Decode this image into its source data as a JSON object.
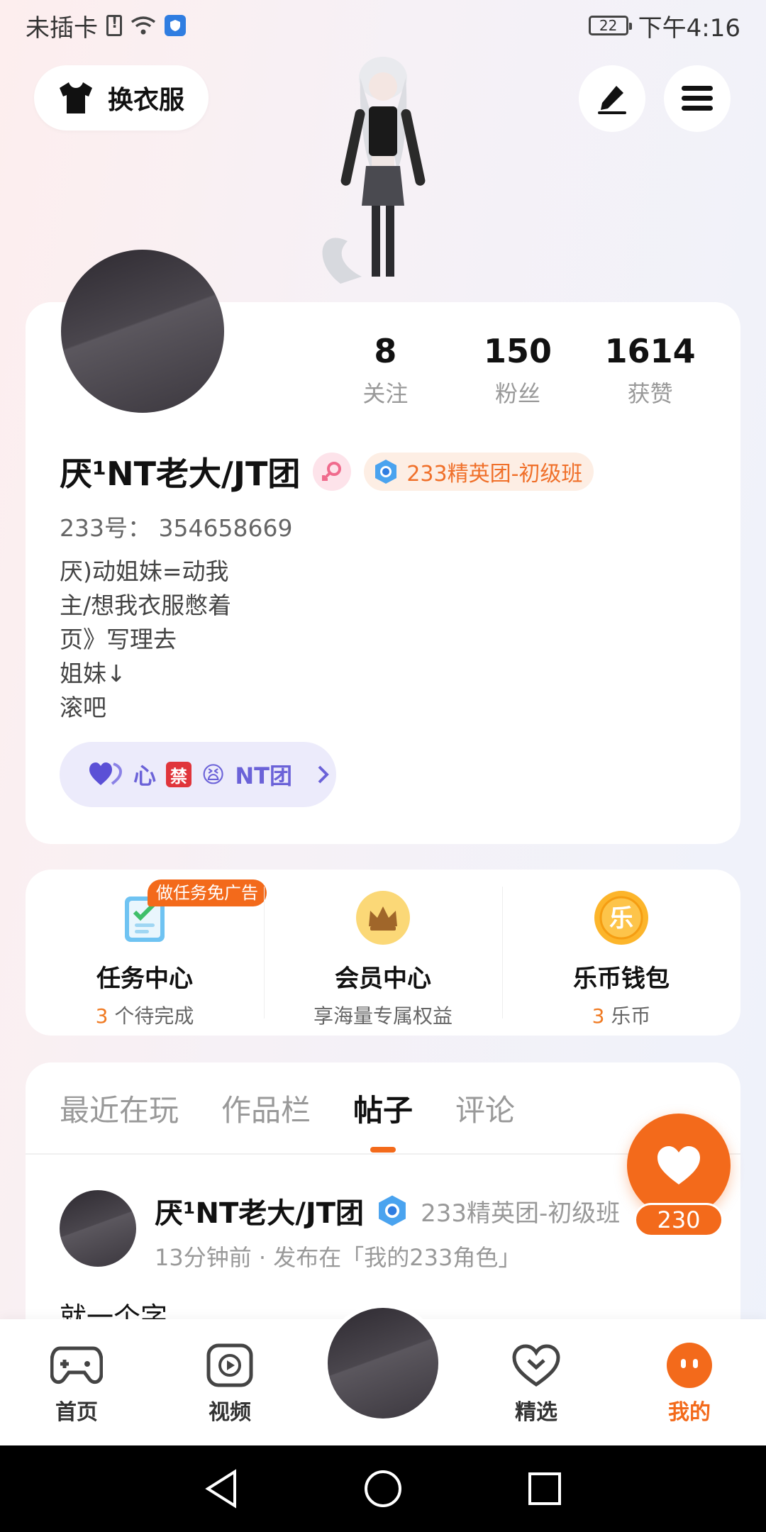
{
  "status_bar": {
    "carrier": "未插卡",
    "battery": "22",
    "time": "下午4:16"
  },
  "header": {
    "outfit_label": "换衣服"
  },
  "profile": {
    "stats": [
      {
        "value": "8",
        "label": "关注"
      },
      {
        "value": "150",
        "label": "粉丝"
      },
      {
        "value": "1614",
        "label": "获赞"
      }
    ],
    "nickname": "厌¹NT老大/JT团",
    "rank": "233精英团-初级班",
    "id_line": "233号： 354658669",
    "bio_lines": [
      "厌)动姐妹=动我",
      "主/想我衣服憋着",
      "页》写理去",
      "姐妹↓",
      "滚吧"
    ],
    "group": {
      "prefix": "心",
      "ban": "禁",
      "face": "😫",
      "suffix": "NT团"
    }
  },
  "services": [
    {
      "title": "任务中心",
      "count": "3",
      "sub": " 个待完成",
      "tag": "做任务免广告"
    },
    {
      "title": "会员中心",
      "sub": "享海量专属权益"
    },
    {
      "title": "乐币钱包",
      "count": "3",
      "sub": " 乐币",
      "icon_text": "乐"
    }
  ],
  "tabs": [
    "最近在玩",
    "作品栏",
    "帖子",
    "评论"
  ],
  "active_tab": "帖子",
  "post": {
    "author": "厌¹NT老大/JT团",
    "rank": "233精英团-初级班",
    "meta": "13分钟前 · 发布在「我的233角色」",
    "text": "就一个字……"
  },
  "like": {
    "count": "230"
  },
  "bottom_nav": [
    {
      "label": "首页",
      "icon": "gamepad-icon"
    },
    {
      "label": "视频",
      "icon": "video-play-icon"
    },
    {
      "label": "精选",
      "icon": "heart-badge-icon"
    },
    {
      "label": "我的",
      "icon": "profile-face-icon"
    }
  ],
  "colors": {
    "accent": "#f36a1b",
    "group_text": "#6b62d8"
  }
}
